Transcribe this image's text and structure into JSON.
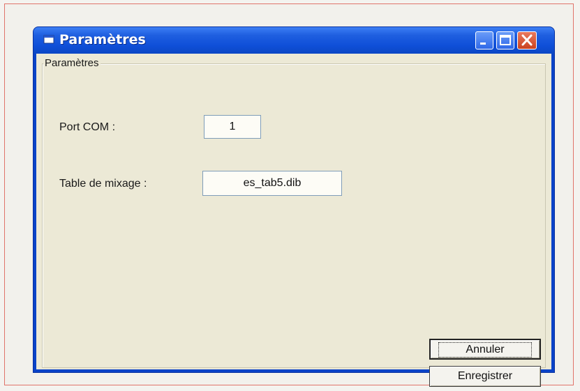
{
  "window": {
    "title": "Paramètres",
    "icon": "app-window-icon",
    "controls": [
      "minimize-icon",
      "maximize-icon",
      "close-icon"
    ]
  },
  "groupbox": {
    "label": "Paramètres"
  },
  "fields": {
    "com_port": {
      "label": "Port COM :",
      "value": "1"
    },
    "mix_table": {
      "label": "Table de mixage :",
      "value": "es_tab5.dib"
    }
  },
  "buttons": {
    "cancel": "Annuler",
    "save": "Enregistrer"
  },
  "colors": {
    "titlebar": "#0f4fd8",
    "close_button": "#c9421f",
    "dialog_face": "#ece9d6"
  }
}
